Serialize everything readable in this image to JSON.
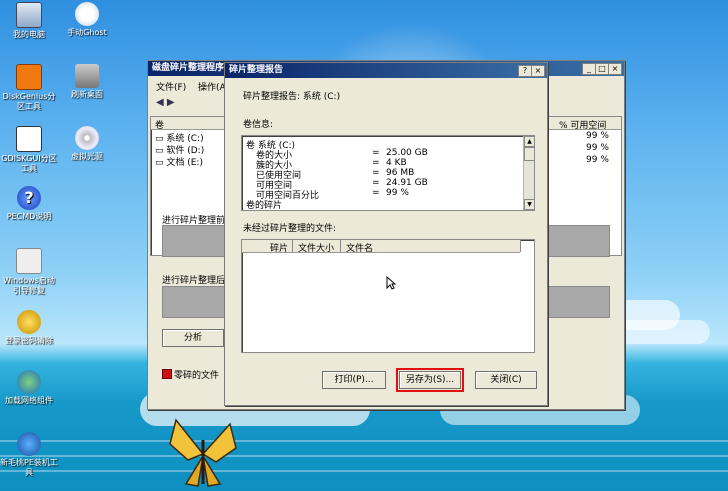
{
  "desktop": {
    "icons": [
      {
        "label": "我的电脑"
      },
      {
        "label": "手动Ghost"
      },
      {
        "label": "DiskGenius分区工具"
      },
      {
        "label": "刷新桌面"
      },
      {
        "label": "GDISKGUI分区工具"
      },
      {
        "label": "虚拟光驱"
      },
      {
        "label": "PECMD说明"
      },
      {
        "label": "Windows启动引导修复"
      },
      {
        "label": "登录密码清除"
      },
      {
        "label": "加载网络组件"
      },
      {
        "label": "新毛桃PE装机工具"
      }
    ]
  },
  "bg_window": {
    "title": "磁盘碎片整理程序",
    "menu": [
      "文件(F)",
      "操作(A"
    ],
    "columns": {
      "vol": "卷",
      "free_pct": "% 可用空间"
    },
    "volumes": [
      {
        "name": "系统 (C:)",
        "pct": "99 %"
      },
      {
        "name": "软件 (D:)",
        "pct": "99 %"
      },
      {
        "name": "文档 (E:)",
        "pct": "99 %"
      }
    ],
    "before_label": "进行碎片整理前",
    "after_label": "进行碎片整理后",
    "analyze_btn": "分析",
    "legend_fragmented": "零碎的文件"
  },
  "dialog": {
    "title": "碎片整理报告",
    "report_for": "碎片整理报告: 系统 (C:)",
    "vol_info_label": "卷信息:",
    "info_rows": [
      {
        "name": "卷 系统 (C:)",
        "eq": "",
        "val": ""
      },
      {
        "name": "卷的大小",
        "eq": "=",
        "val": "25.00 GB"
      },
      {
        "name": "簇的大小",
        "eq": "=",
        "val": "4 KB"
      },
      {
        "name": "已使用空间",
        "eq": "=",
        "val": "96 MB"
      },
      {
        "name": "可用空间",
        "eq": "=",
        "val": "24.91 GB"
      },
      {
        "name": "可用空间百分比",
        "eq": "=",
        "val": "99 %"
      },
      {
        "name": "卷的碎片",
        "eq": "",
        "val": ""
      }
    ],
    "unfrag_label": "未经过碎片整理的文件:",
    "table_cols": [
      "碎片",
      "文件大小",
      "文件名"
    ],
    "print_btn": "打印(P)...",
    "saveas_btn": "另存为(S)...",
    "close_btn": "关闭(C)",
    "highlight_color": "#e01010"
  }
}
